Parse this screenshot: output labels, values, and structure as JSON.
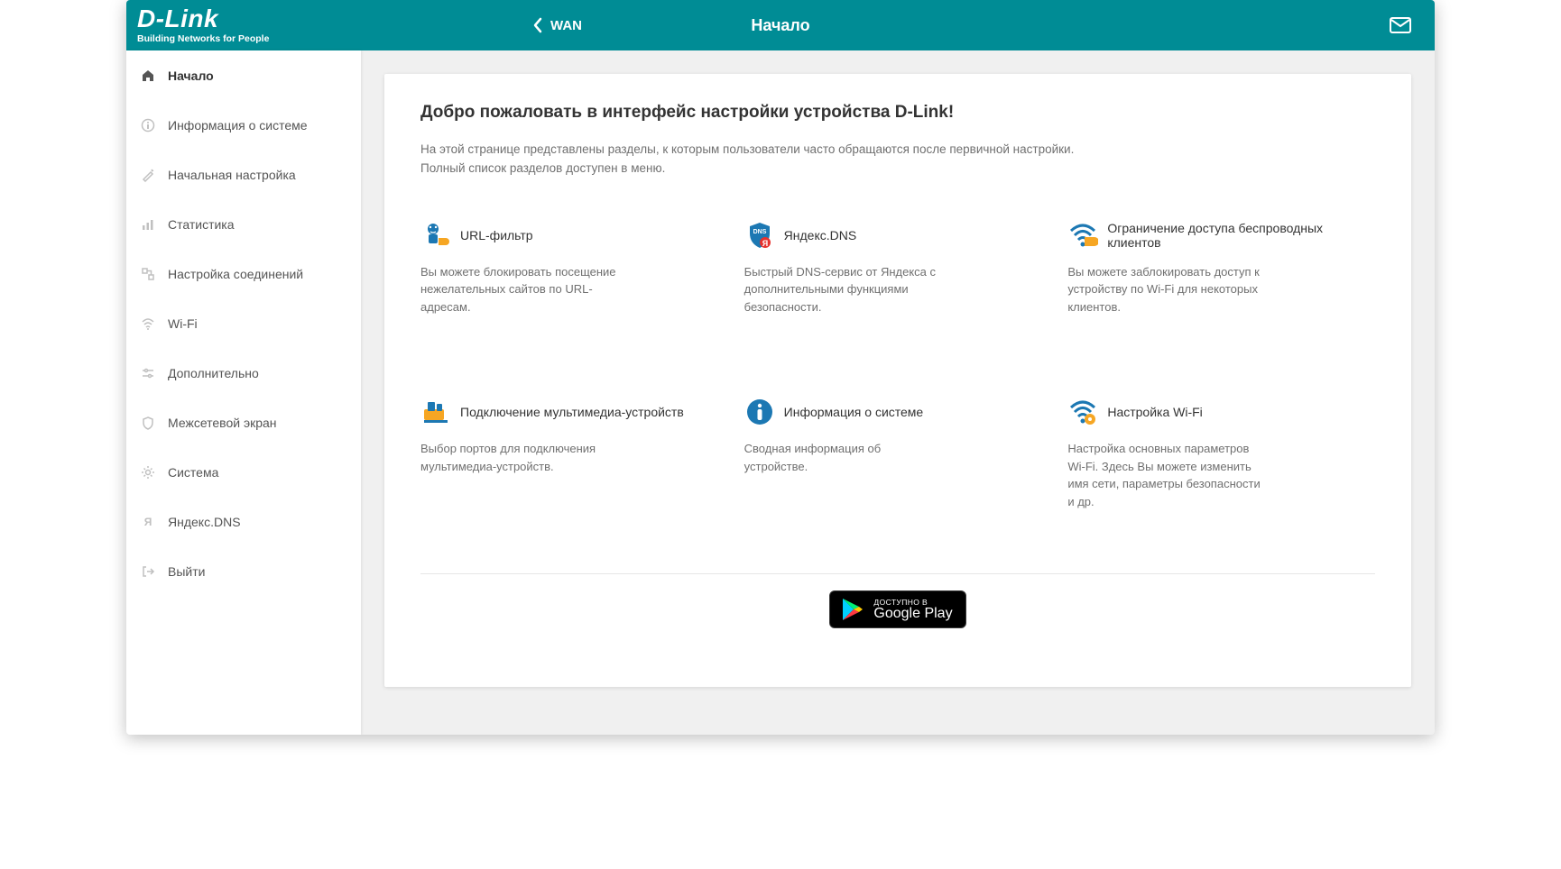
{
  "brand": {
    "name": "D-Link",
    "tagline": "Building Networks for People"
  },
  "header": {
    "back_label": "WAN",
    "title": "Начало"
  },
  "sidebar": {
    "items": [
      {
        "label": "Начало",
        "icon": "home-icon",
        "active": true
      },
      {
        "label": "Информация о системе",
        "icon": "info-icon"
      },
      {
        "label": "Начальная настройка",
        "icon": "wand-icon"
      },
      {
        "label": "Статистика",
        "icon": "chart-icon"
      },
      {
        "label": "Настройка соединений",
        "icon": "connections-icon"
      },
      {
        "label": "Wi-Fi",
        "icon": "wifi-icon"
      },
      {
        "label": "Дополнительно",
        "icon": "advanced-icon"
      },
      {
        "label": "Межсетевой экран",
        "icon": "shield-icon"
      },
      {
        "label": "Система",
        "icon": "gear-icon"
      },
      {
        "label": "Яндекс.DNS",
        "icon": "yandex-icon"
      },
      {
        "label": "Выйти",
        "icon": "logout-icon"
      }
    ]
  },
  "main": {
    "welcome_title": "Добро пожаловать в интерфейс настройки устройства D-Link!",
    "welcome_text": "На этой странице представлены разделы, к которым пользователи часто обращаются после первичной настройки. Полный список разделов доступен в меню.",
    "tiles": [
      {
        "title": "URL-фильтр",
        "desc": "Вы можете блокировать посещение нежелательных сайтов по URL-адресам."
      },
      {
        "title": "Яндекс.DNS",
        "desc": "Быстрый DNS-сервис от Яндекса с дополнительными функциями безопасности."
      },
      {
        "title": "Ограничение доступа беспроводных клиентов",
        "desc": "Вы можете заблокировать доступ к устройству по Wi-Fi для некоторых клиентов."
      },
      {
        "title": "Подключение мультимедиа-устройств",
        "desc": "Выбор портов для подключения мультимедиа-устройств."
      },
      {
        "title": "Информация о системе",
        "desc": "Сводная информация об устройстве."
      },
      {
        "title": "Настройка Wi-Fi",
        "desc": "Настройка основных параметров Wi-Fi. Здесь Вы можете изменить имя сети, параметры безопасности и др."
      }
    ],
    "store": {
      "available": "ДОСТУПНО В",
      "name": "Google Play"
    }
  }
}
